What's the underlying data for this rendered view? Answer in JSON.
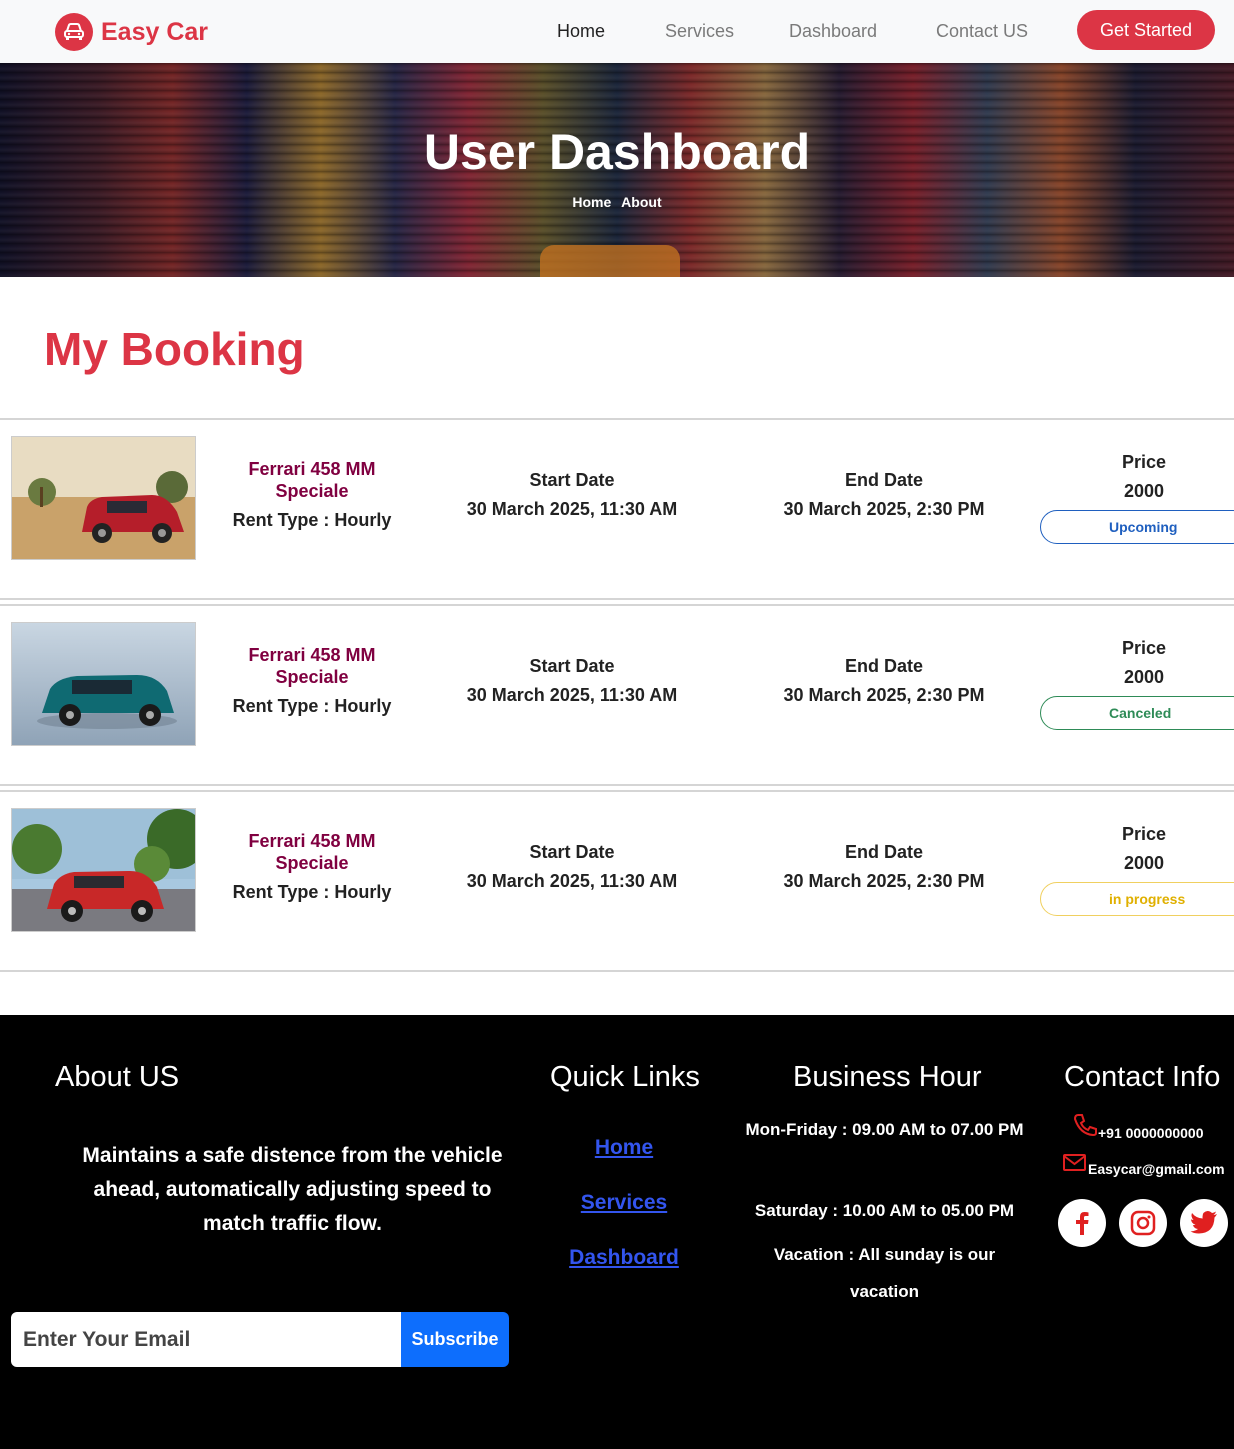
{
  "brand": {
    "name": "Easy Car",
    "color": "#dc3545"
  },
  "nav": {
    "items": [
      {
        "label": "Home",
        "active": true
      },
      {
        "label": "Services",
        "active": false
      },
      {
        "label": "Dashboard",
        "active": false
      },
      {
        "label": "Contact US",
        "active": false
      }
    ],
    "cta_label": "Get Started"
  },
  "hero": {
    "title": "User Dashboard",
    "breadcrumbs": [
      "Home",
      "About"
    ]
  },
  "section_title": "My Booking",
  "bookings": [
    {
      "car_name": "Ferrari 458 MM Speciale",
      "rent_type": "Rent Type : Hourly",
      "start_label": "Start Date",
      "start_value": "30 March 2025, 11:30 AM",
      "end_label": "End Date",
      "end_value": "30 March 2025, 2:30 PM",
      "price_label": "Price",
      "price_value": "2000",
      "status": "Upcoming",
      "status_color": "#1f5fbf",
      "image_icon": "red-suv-image"
    },
    {
      "car_name": "Ferrari 458 MM Speciale",
      "rent_type": "Rent Type : Hourly",
      "start_label": "Start Date",
      "start_value": "30 March 2025, 11:30 AM",
      "end_label": "End Date",
      "end_value": "30 March 2025, 2:30 PM",
      "price_label": "Price",
      "price_value": "2000",
      "status": "Canceled",
      "status_color": "#2e8b57",
      "image_icon": "teal-suv-image"
    },
    {
      "car_name": "Ferrari 458 MM Speciale",
      "rent_type": "Rent Type : Hourly",
      "start_label": "Start Date",
      "start_value": "30 March 2025, 11:30 AM",
      "end_label": "End Date",
      "end_value": "30 March 2025, 2:30 PM",
      "price_label": "Price",
      "price_value": "2000",
      "status": "in progress",
      "status_color": "#e0b000",
      "image_icon": "red-suv-road-image"
    }
  ],
  "footer": {
    "about_heading": "About US",
    "about_text": "Maintains a safe distence from the vehicle ahead, automatically adjusting speed to match traffic flow.",
    "quick_links_heading": "Quick Links",
    "quick_links": [
      "Home",
      "Services",
      "Dashboard"
    ],
    "hours_heading": "Business Hour",
    "hours": [
      "Mon-Friday : 09.00 AM to 07.00 PM",
      "Saturday : 10.00 AM to 05.00 PM",
      "Vacation : All sunday is our vacation"
    ],
    "contact_heading": "Contact Info",
    "phone": "+91 0000000000",
    "email": "Easycar@gmail.com",
    "socials": [
      "facebook-icon",
      "instagram-icon",
      "twitter-icon"
    ],
    "email_placeholder": "Enter Your Email",
    "subscribe_label": "Subscribe"
  }
}
